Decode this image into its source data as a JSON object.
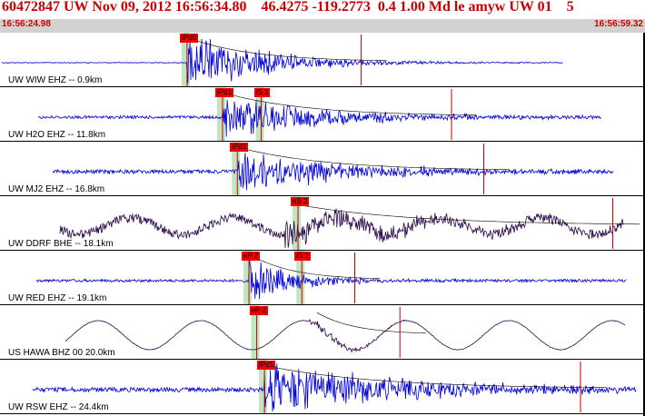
{
  "header": {
    "title": "60472847 UW Nov 09, 2012 16:56:34.80    46.4275 -119.2773  0.4 1.00 Md le amyw UW 01    5",
    "start_time": "16:56:24.98",
    "end_time": "16:56:59.32"
  },
  "colors": {
    "title": "#c80000",
    "trace_blue": "#0000dd",
    "trace_dark": "#2a0a4a",
    "pick_box": "#ee0000",
    "window_shade": "#bfe6bf",
    "pick_line": "#cc0000",
    "time_bar": "#d2d2d2"
  },
  "panels": [
    {
      "label": "UW WIW EHZ -- 0.9km",
      "color": "blue",
      "picks": [
        {
          "text": "iPd0",
          "pos": 0.29
        }
      ]
    },
    {
      "label": "UW H2O EHZ -- 11.8km",
      "color": "blue",
      "picks": [
        {
          "text": "iPd1",
          "pos": 0.345
        },
        {
          "text": "iS 1",
          "pos": 0.405
        }
      ]
    },
    {
      "label": "UW MJ2 EHZ -- 16.8km",
      "color": "blue",
      "picks": [
        {
          "text": "iPd1",
          "pos": 0.368
        }
      ]
    },
    {
      "label": "UW DDRF BHE -- 18.1km",
      "color": "dark",
      "picks": [
        {
          "text": "eS 2",
          "pos": 0.462
        }
      ]
    },
    {
      "label": "UW RED EHZ -- 19.1km",
      "color": "blue",
      "picks": [
        {
          "text": "eP 2",
          "pos": 0.386
        },
        {
          "text": "iS 1",
          "pos": 0.468
        }
      ]
    },
    {
      "label": "US HAWA BHZ 00 20.0km",
      "color": "dark",
      "picks": [
        {
          "text": "eP 2",
          "pos": 0.398
        }
      ]
    },
    {
      "label": "UW RSW EHZ -- 24.4km",
      "color": "blue",
      "picks": [
        {
          "text": "iPd1",
          "pos": 0.41
        }
      ]
    }
  ]
}
